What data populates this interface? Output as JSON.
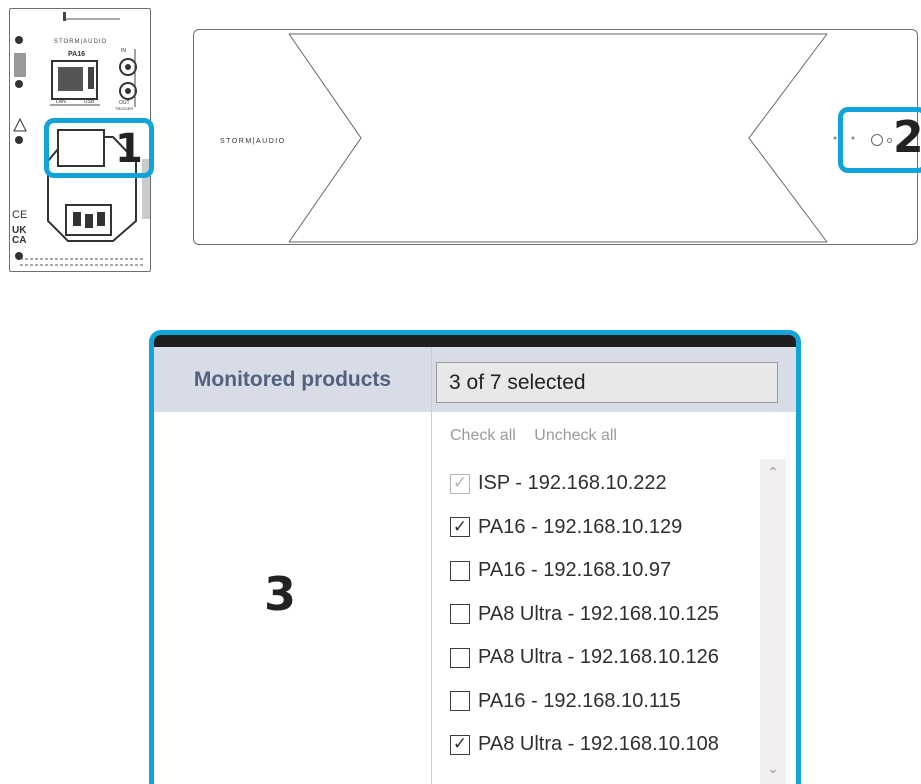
{
  "hardware": {
    "brand": "STORM|AUDIO",
    "rear_model": "PA16",
    "rear_port_lan": "LAN",
    "rear_port_usb": "USB",
    "rear_trigger_in": "IN",
    "rear_trigger_out": "OUT",
    "rear_trigger_label": "TRIGGER",
    "rear_mark_ce": "CE",
    "rear_mark_ukca": "UK CA"
  },
  "callouts": {
    "one": "1",
    "two": "2",
    "three": "3"
  },
  "dialog": {
    "label": "Monitored products",
    "selected_summary": "3 of 7 selected",
    "check_all": "Check all",
    "uncheck_all": "Uncheck all",
    "items": [
      {
        "label": "ISP - 192.168.10.222",
        "checked": true,
        "disabled": true
      },
      {
        "label": "PA16 - 192.168.10.129",
        "checked": true,
        "disabled": false
      },
      {
        "label": "PA16 - 192.168.10.97",
        "checked": false,
        "disabled": false
      },
      {
        "label": "PA8 Ultra - 192.168.10.125",
        "checked": false,
        "disabled": false
      },
      {
        "label": "PA8 Ultra - 192.168.10.126",
        "checked": false,
        "disabled": false
      },
      {
        "label": "PA16 - 192.168.10.115",
        "checked": false,
        "disabled": false
      },
      {
        "label": "PA8 Ultra - 192.168.10.108",
        "checked": true,
        "disabled": false
      }
    ]
  },
  "colors": {
    "callout_border": "#12a4d8",
    "header_bg": "#d7dce6",
    "header_text": "#52627e"
  }
}
